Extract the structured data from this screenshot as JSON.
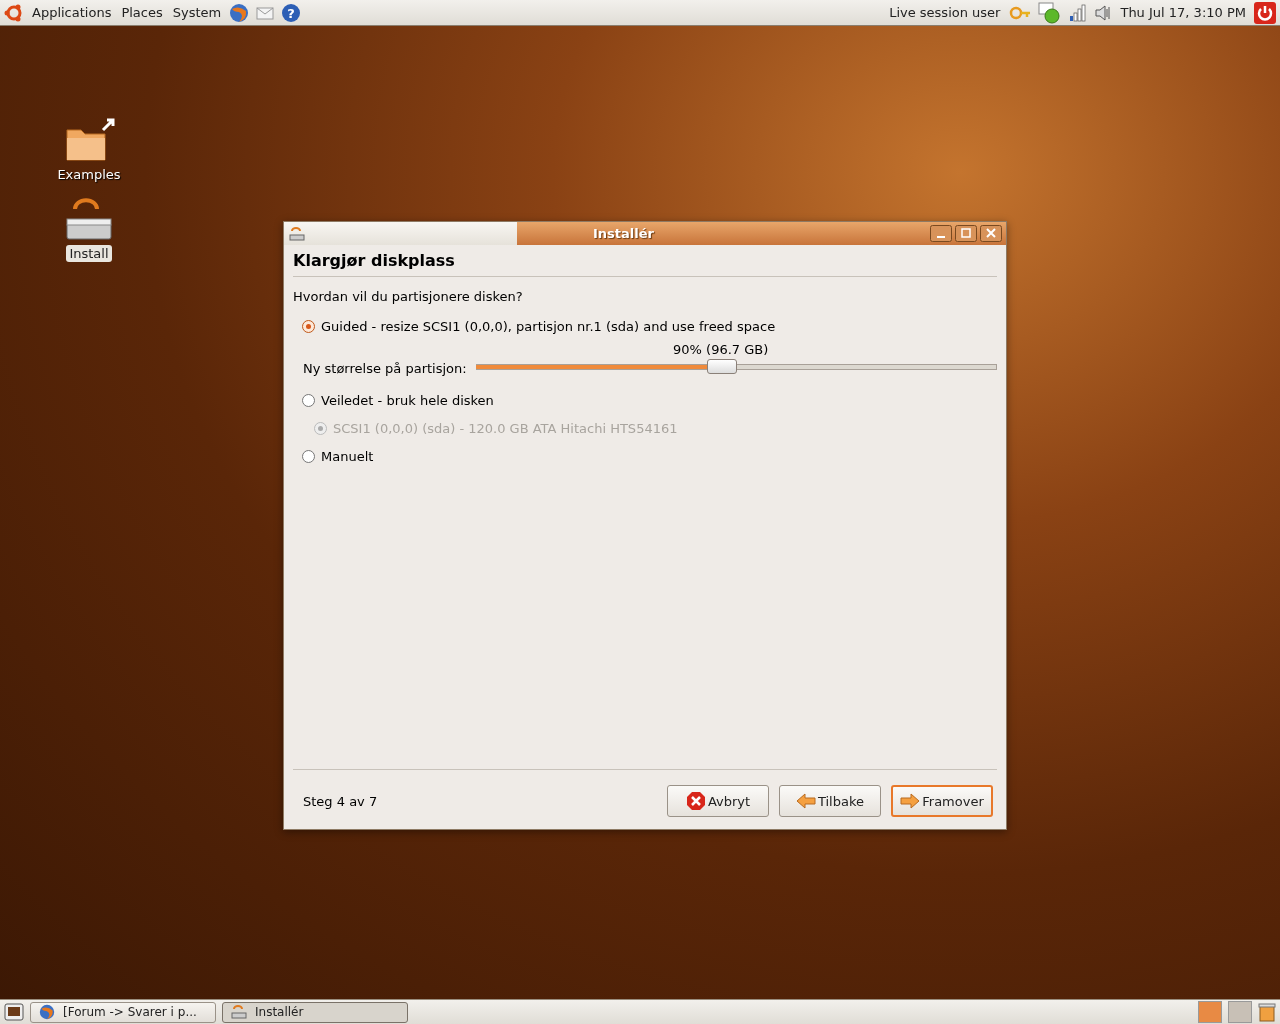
{
  "top_panel": {
    "menus": [
      "Applications",
      "Places",
      "System"
    ],
    "help_glyph": "?",
    "user": "Live session user",
    "clock": "Thu Jul 17,  3:10 PM"
  },
  "desktop_icons": [
    {
      "kind": "folder",
      "label": "Examples",
      "selected": false
    },
    {
      "kind": "installer",
      "label": "Install",
      "selected": true
    }
  ],
  "window": {
    "title": "Installér",
    "heading": "Klargjør diskplass",
    "question": "Hvordan vil du partisjonere disken?",
    "options": [
      {
        "kind": "radio",
        "label": "Guided - resize SCSI1 (0,0,0), partisjon nr.1 (sda) and use freed space",
        "selected": true,
        "disabled": false
      },
      {
        "kind": "slider",
        "label": "Ny størrelse på partisjon:",
        "reading": "90% (96.7 GB)",
        "level": 0.47
      },
      {
        "kind": "radio",
        "label": "Veiledet - bruk hele disken",
        "selected": false,
        "disabled": false
      },
      {
        "kind": "subradio",
        "label": "SCSI1 (0,0,0) (sda) - 120.0 GB ATA Hitachi HTS54161",
        "selected": true,
        "disabled": true
      },
      {
        "kind": "radio",
        "label": "Manuelt",
        "selected": false,
        "disabled": false
      }
    ],
    "step": "Steg 4 av 7",
    "buttons": [
      {
        "kind": "cancel",
        "label": "Avbryt",
        "default": false
      },
      {
        "kind": "back",
        "label": "Tilbake",
        "default": false
      },
      {
        "kind": "forward",
        "label": "Framover",
        "default": true
      }
    ]
  },
  "taskbar": [
    {
      "kind": "browser",
      "label": "[Forum -> Svarer i p...",
      "selected": false
    },
    {
      "kind": "installer",
      "label": "Installér",
      "selected": true
    }
  ]
}
